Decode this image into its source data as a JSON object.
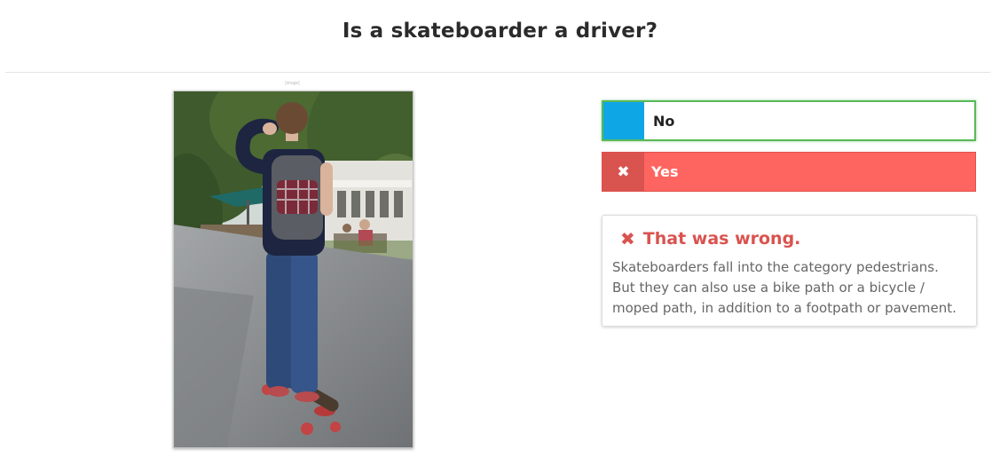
{
  "question": {
    "title": "Is a skateboarder a driver?"
  },
  "image": {
    "credit": "[image]",
    "alt": "Skateboarder riding a longboard on a path"
  },
  "answers": [
    {
      "label": "No",
      "state": "correct",
      "color": "#0fa6e6",
      "border_color": "#58b957"
    },
    {
      "label": "Yes",
      "state": "selected-wrong",
      "color": "#ff6560",
      "icon": "close-icon",
      "icon_glyph": "✖"
    }
  ],
  "feedback": {
    "icon": "close-icon",
    "icon_glyph": "✖",
    "heading": "That was wrong.",
    "lines": [
      "Skateboarders fall into the category pedestrians.",
      "But they can also use a bike path or a bicycle /",
      "moped path, in addition to a footpath or pavement."
    ],
    "color": "#d9534f"
  }
}
